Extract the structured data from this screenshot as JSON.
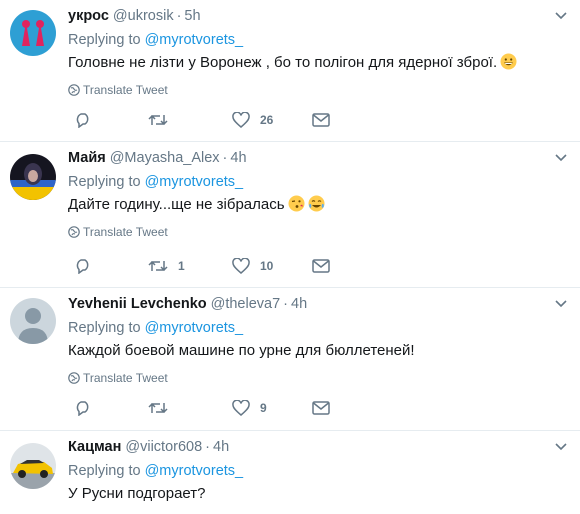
{
  "tweets": [
    {
      "display_name": "укрос",
      "handle": "@ukrosik",
      "sep": "·",
      "time": "5h",
      "replying_prefix": "Replying to",
      "replying_to": "@myrotvorets_",
      "text": "Головне не лізти у Воронеж , бо то полігон для ядерної зброї.",
      "emoji": [
        "grinning-face"
      ],
      "translate": "Translate Tweet",
      "reply_count": "",
      "retweet_count": "",
      "like_count": "26"
    },
    {
      "display_name": "Майя",
      "handle": "@Mayasha_Alex",
      "sep": "·",
      "time": "4h",
      "replying_prefix": "Replying to",
      "replying_to": "@myrotvorets_",
      "text": "Дайте годину...ще не зібралась",
      "emoji": [
        "winking-kiss-face",
        "tears-of-joy-face"
      ],
      "translate": "Translate Tweet",
      "reply_count": "",
      "retweet_count": "1",
      "like_count": "10"
    },
    {
      "display_name": "Yevhenii Levchenko",
      "handle": "@theleva7",
      "sep": "·",
      "time": "4h",
      "replying_prefix": "Replying to",
      "replying_to": "@myrotvorets_",
      "text": "Каждой боевой машине по урне для бюллетеней!",
      "emoji": [],
      "translate": "Translate Tweet",
      "reply_count": "",
      "retweet_count": "",
      "like_count": "9"
    },
    {
      "display_name": "Кацман",
      "handle": "@viictor608",
      "sep": "·",
      "time": "4h",
      "replying_prefix": "Replying to",
      "replying_to": "@myrotvorets_",
      "text": "У Русни подгорает?",
      "emoji": [],
      "translate": "",
      "reply_count": "",
      "retweet_count": "",
      "like_count": ""
    }
  ],
  "colors": {
    "link": "#1b95e0",
    "secondary_text": "#657786",
    "divider": "#e6ecf0"
  },
  "icons": [
    "reply-icon",
    "retweet-icon",
    "like-icon",
    "direct-message-icon",
    "globe-icon",
    "chevron-down-icon"
  ]
}
